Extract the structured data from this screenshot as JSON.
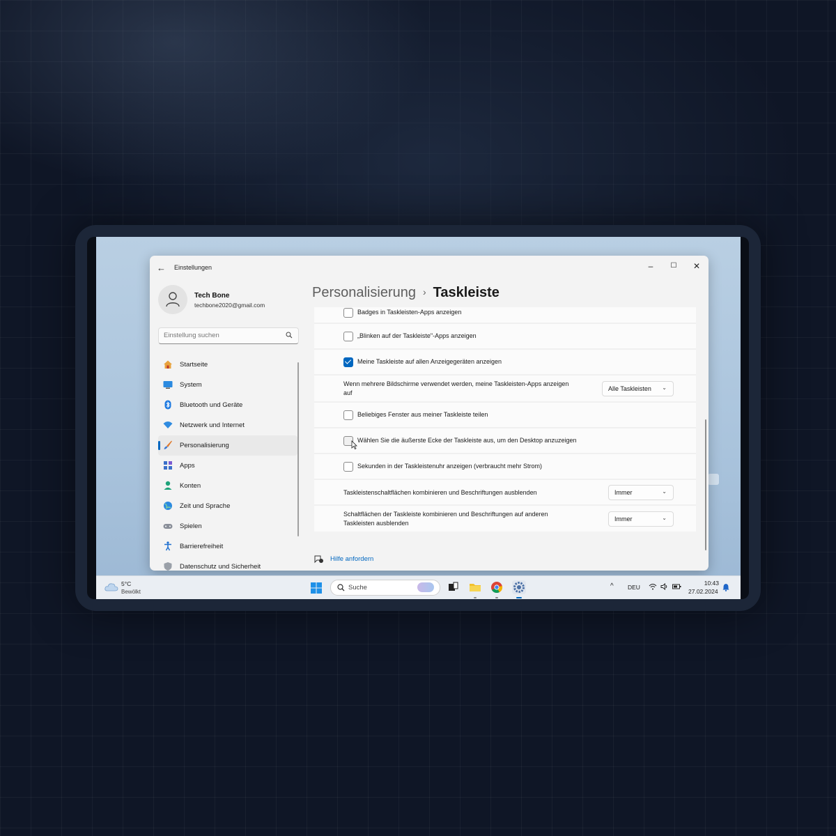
{
  "window": {
    "title": "Einstellungen",
    "controls": {
      "minimize": "–",
      "maximize": "☐",
      "close": "✕"
    }
  },
  "profile": {
    "name": "Tech Bone",
    "email": "techbone2020@gmail.com"
  },
  "search": {
    "placeholder": "Einstellung suchen"
  },
  "sidebar": {
    "items": [
      {
        "label": "Startseite",
        "icon": "home-icon"
      },
      {
        "label": "System",
        "icon": "monitor-icon"
      },
      {
        "label": "Bluetooth und Geräte",
        "icon": "bluetooth-icon"
      },
      {
        "label": "Netzwerk und Internet",
        "icon": "wifi-icon"
      },
      {
        "label": "Personalisierung",
        "icon": "brush-icon",
        "active": true
      },
      {
        "label": "Apps",
        "icon": "apps-icon"
      },
      {
        "label": "Konten",
        "icon": "account-icon"
      },
      {
        "label": "Zeit und Sprache",
        "icon": "globe-icon"
      },
      {
        "label": "Spielen",
        "icon": "gamepad-icon"
      },
      {
        "label": "Barrierefreiheit",
        "icon": "accessibility-icon"
      },
      {
        "label": "Datenschutz und Sicherheit",
        "icon": "shield-icon"
      }
    ]
  },
  "breadcrumb": {
    "parent": "Personalisierung",
    "separator": "›",
    "current": "Taskleiste"
  },
  "settings": [
    {
      "type": "checkbox",
      "label": "Badges in Taskleisten-Apps anzeigen",
      "checked": false
    },
    {
      "type": "checkbox",
      "label": "„Blinken auf der Taskleiste\"-Apps anzeigen",
      "checked": false
    },
    {
      "type": "checkbox",
      "label": "Meine Taskleiste auf allen Anzeigegeräten anzeigen",
      "checked": true
    },
    {
      "type": "dropdown",
      "label": "Wenn mehrere Bildschirme verwendet werden, meine Taskleisten-Apps anzeigen auf",
      "value": "Alle Taskleisten"
    },
    {
      "type": "checkbox",
      "label": "Beliebiges Fenster aus meiner Taskleiste teilen",
      "checked": false
    },
    {
      "type": "checkbox",
      "label": "Wählen Sie die äußerste Ecke der Taskleiste aus, um den Desktop anzuzeigen",
      "checked": false
    },
    {
      "type": "checkbox",
      "label": "Sekunden in der Taskleistenuhr anzeigen (verbraucht mehr Strom)",
      "checked": false
    },
    {
      "type": "dropdown",
      "label": "Taskleistenschaltflächen kombinieren und Beschriftungen ausblenden",
      "value": "Immer"
    },
    {
      "type": "dropdown",
      "label": "Schaltflächen der Taskleiste kombinieren und Beschriftungen auf anderen Taskleisten ausblenden",
      "value": "Immer"
    }
  ],
  "help": {
    "label": "Hilfe anfordern"
  },
  "taskbar": {
    "weather": {
      "temp": "5°C",
      "condition": "Bewölkt"
    },
    "search_label": "Suche",
    "apps": [
      "start-icon",
      "task-view-icon",
      "file-explorer-icon",
      "chrome-icon",
      "settings-icon"
    ],
    "tray": {
      "chevron": "^",
      "language": "DEU",
      "time": "10:43",
      "date": "27.02.2024"
    }
  },
  "colors": {
    "accent": "#0067c0",
    "window_bg": "#f3f3f3",
    "card_bg": "#fbfbfb",
    "page_bg": "#0f1626"
  }
}
